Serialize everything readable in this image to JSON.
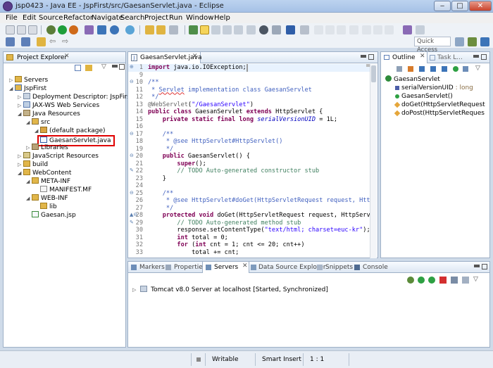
{
  "window": {
    "title": "jsp0423 - Java EE - JspFirst/src/GaesanServlet.java - Eclipse"
  },
  "menu": [
    "File",
    "Edit",
    "Source",
    "Refactor",
    "Navigate",
    "Search",
    "Project",
    "Run",
    "Window",
    "Help"
  ],
  "quick_access": "Quick Access",
  "project_explorer": {
    "title": "Project Explorer",
    "items": [
      {
        "label": "Servers",
        "indent": 0,
        "tw": "▷",
        "icon": "folder"
      },
      {
        "label": "JspFirst",
        "indent": 0,
        "tw": "◢",
        "icon": "project"
      },
      {
        "label": "Deployment Descriptor: JspFirst",
        "indent": 1,
        "tw": "▷",
        "icon": "descriptor"
      },
      {
        "label": "JAX-WS Web Services",
        "indent": 1,
        "tw": "▷",
        "icon": "ws"
      },
      {
        "label": "Java Resources",
        "indent": 1,
        "tw": "◢",
        "icon": "jres"
      },
      {
        "label": "src",
        "indent": 2,
        "tw": "◢",
        "icon": "src"
      },
      {
        "label": "(default package)",
        "indent": 3,
        "tw": "◢",
        "icon": "pkg"
      },
      {
        "label": "GaesanServlet.java",
        "indent": 4,
        "tw": "▷",
        "icon": "java",
        "selected": true
      },
      {
        "label": "Libraries",
        "indent": 2,
        "tw": "▷",
        "icon": "lib"
      },
      {
        "label": "JavaScript Resources",
        "indent": 1,
        "tw": "▷",
        "icon": "js"
      },
      {
        "label": "build",
        "indent": 1,
        "tw": "▷",
        "icon": "folder"
      },
      {
        "label": "WebContent",
        "indent": 1,
        "tw": "◢",
        "icon": "folder"
      },
      {
        "label": "META-INF",
        "indent": 2,
        "tw": "◢",
        "icon": "folder"
      },
      {
        "label": "MANIFEST.MF",
        "indent": 3,
        "tw": "",
        "icon": "file"
      },
      {
        "label": "WEB-INF",
        "indent": 2,
        "tw": "◢",
        "icon": "folder"
      },
      {
        "label": "lib",
        "indent": 3,
        "tw": "",
        "icon": "folder"
      },
      {
        "label": "Gaesan.jsp",
        "indent": 2,
        "tw": "",
        "icon": "jsp"
      }
    ]
  },
  "editor": {
    "tab": "GaesanServlet.java",
    "lines": [
      {
        "n": "1",
        "m": "⊕",
        "html": "<span class=\"kw\">import</span> java.io.IOException;<span style=\"border:1px solid #999\">&#8203;</span>"
      },
      {
        "n": "9",
        "m": "",
        "html": ""
      },
      {
        "n": "10",
        "m": "⊖",
        "html": "<span class=\"jd\">/**</span>"
      },
      {
        "n": "11",
        "m": "",
        "html": "<span class=\"jd\"> * <span style=\"text-decoration:underline wavy #d33\">Servlet</span> implementation class GaesanServlet</span>"
      },
      {
        "n": "12",
        "m": "",
        "html": "<span class=\"jd\"> */</span>"
      },
      {
        "n": "13",
        "m": "",
        "html": "<span class=\"an\">@WebServlet</span>(<span class=\"st\">\"/GaesanServlet\"</span>)"
      },
      {
        "n": "14",
        "m": "",
        "html": "<span class=\"kw\">public class</span> GaesanServlet <span class=\"kw\">extends</span> HttpServlet {"
      },
      {
        "n": "15",
        "m": "",
        "html": "    <span class=\"kw\">private static final long</span> <span class=\"fld\">serialVersionUID</span> = 1L;"
      },
      {
        "n": "16",
        "m": "",
        "html": ""
      },
      {
        "n": "17",
        "m": "⊖",
        "html": "    <span class=\"jd\">/**</span>"
      },
      {
        "n": "18",
        "m": "",
        "html": "<span class=\"jd\">     * @see HttpServlet#HttpServlet()</span>"
      },
      {
        "n": "19",
        "m": "",
        "html": "<span class=\"jd\">     */</span>"
      },
      {
        "n": "20",
        "m": "⊖",
        "html": "    <span class=\"kw\">public</span> GaesanServlet() {"
      },
      {
        "n": "21",
        "m": "",
        "html": "        <span class=\"kw\">super</span>();"
      },
      {
        "n": "22",
        "m": "✎",
        "html": "        <span class=\"cm\">// TODO Auto-generated constructor stub</span>"
      },
      {
        "n": "23",
        "m": "",
        "html": "    }"
      },
      {
        "n": "24",
        "m": "",
        "html": ""
      },
      {
        "n": "25",
        "m": "⊖",
        "html": "    <span class=\"jd\">/**</span>"
      },
      {
        "n": "26",
        "m": "",
        "html": "<span class=\"jd\">     * @see HttpServlet#doGet(HttpServletRequest request, HttpSe</span>"
      },
      {
        "n": "27",
        "m": "",
        "html": "<span class=\"jd\">     */</span>"
      },
      {
        "n": "28",
        "m": "▲⊖",
        "html": "    <span class=\"kw\">protected void</span> doGet(HttpServletRequest request, HttpServlet"
      },
      {
        "n": "29",
        "m": "✎",
        "html": "        <span class=\"cm\">// TODO Auto-generated method stub</span>"
      },
      {
        "n": "30",
        "m": "",
        "html": "        response.setContentType(<span class=\"st\">\"text/html; charset=euc-kr\"</span>);"
      },
      {
        "n": "31",
        "m": "",
        "html": "        <span class=\"kw\">int</span> total = 0;"
      },
      {
        "n": "32",
        "m": "",
        "html": "        <span class=\"kw\">for</span> (<span class=\"kw\">int</span> cnt = 1; cnt &lt;= 20; cnt++)"
      },
      {
        "n": "33",
        "m": "",
        "html": "            total += cnt;"
      }
    ]
  },
  "outline": {
    "title": "Outline",
    "tab2": "Task L...",
    "items": [
      {
        "label": "GaesanServlet",
        "indent": 0,
        "icon": "class"
      },
      {
        "label": "serialVersionUID",
        "suffix": " : long",
        "indent": 1,
        "icon": "field"
      },
      {
        "label": "GaesanServlet()",
        "indent": 1,
        "icon": "ctor"
      },
      {
        "label": "doGet(HttpServletRequest",
        "indent": 1,
        "icon": "method"
      },
      {
        "label": "doPost(HttpServletReques",
        "indent": 1,
        "icon": "method"
      }
    ]
  },
  "bottom": {
    "tabs": [
      "Markers",
      "Properties",
      "Servers",
      "Data Source Explorer",
      "Snippets",
      "Console"
    ],
    "active_tab": "Servers",
    "server_row": "Tomcat v8.0 Server at localhost  [Started, Synchronized]"
  },
  "status": {
    "writable": "Writable",
    "insert": "Smart Insert",
    "position": "1 : 1"
  }
}
